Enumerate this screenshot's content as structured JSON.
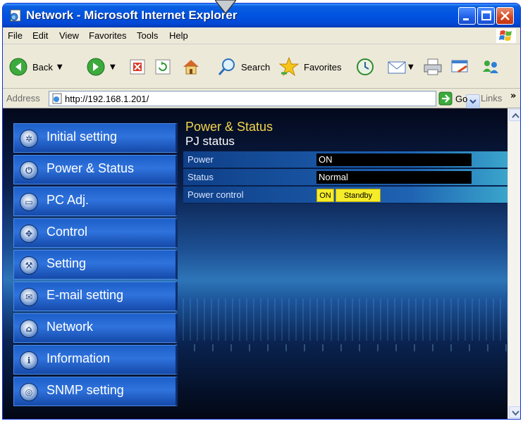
{
  "window": {
    "title": "Network - Microsoft Internet Explorer"
  },
  "menu": [
    "File",
    "Edit",
    "View",
    "Favorites",
    "Tools",
    "Help"
  ],
  "toolbar": {
    "back": "Back",
    "search": "Search",
    "favorites": "Favorites"
  },
  "address": {
    "label": "Address",
    "url": "http://192.168.1.201/",
    "go": "Go",
    "links": "Links",
    "chevron": "»"
  },
  "sidebar": {
    "items": [
      {
        "label": "Initial setting",
        "icon": "gear-icon"
      },
      {
        "label": "Power & Status",
        "icon": "power-icon"
      },
      {
        "label": "PC Adj.",
        "icon": "monitor-icon"
      },
      {
        "label": "Control",
        "icon": "control-icon"
      },
      {
        "label": "Setting",
        "icon": "wrench-icon"
      },
      {
        "label": "E-mail setting",
        "icon": "mail-icon"
      },
      {
        "label": "Network",
        "icon": "network-icon"
      },
      {
        "label": "Information",
        "icon": "info-icon"
      },
      {
        "label": "SNMP setting",
        "icon": "snmp-icon"
      }
    ]
  },
  "panel": {
    "title": "Power & Status",
    "subtitle": "PJ status",
    "rows": [
      {
        "label": "Power",
        "value": "ON"
      },
      {
        "label": "Status",
        "value": "Normal"
      },
      {
        "label": "Power control"
      }
    ],
    "power_on_label": "ON",
    "standby_label": "Standby"
  },
  "colors": {
    "title_bar": "#0053e1",
    "panel_title": "#f2d64a",
    "control_button": "#f5ec2a"
  }
}
